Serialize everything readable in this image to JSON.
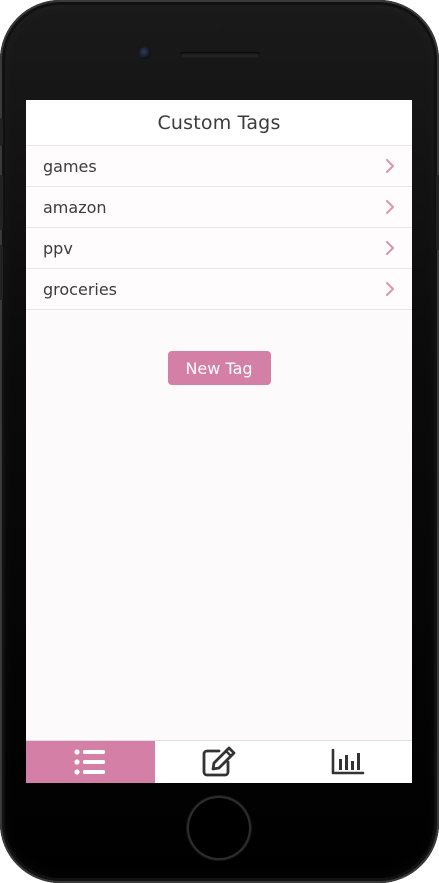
{
  "header": {
    "title": "Custom Tags"
  },
  "tags": [
    {
      "label": "games"
    },
    {
      "label": "amazon"
    },
    {
      "label": "ppv"
    },
    {
      "label": "groceries"
    }
  ],
  "new_tag_button": {
    "label": "New Tag"
  },
  "tabbar": {
    "tabs": [
      {
        "icon": "list-icon",
        "active": true
      },
      {
        "icon": "edit-icon",
        "active": false
      },
      {
        "icon": "bar-chart-icon",
        "active": false
      }
    ]
  },
  "colors": {
    "accent": "#d47fa6",
    "chevron": "#d99ab6",
    "text": "#3c3c3c",
    "background": "#fdfafb"
  }
}
